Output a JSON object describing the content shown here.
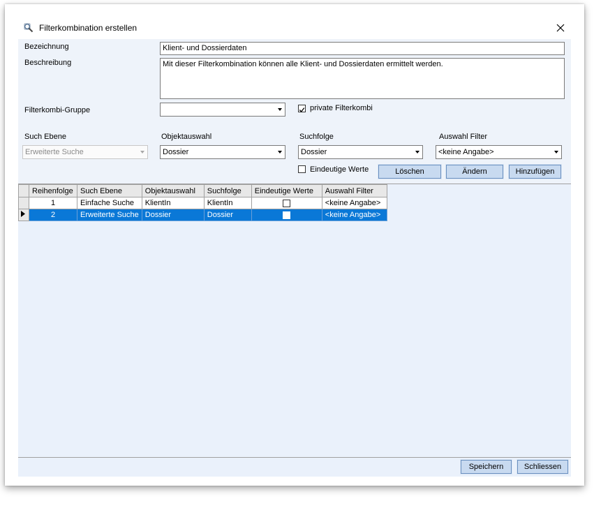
{
  "window": {
    "title": "Filterkombination erstellen"
  },
  "form": {
    "bezeichnung_label": "Bezeichnung",
    "bezeichnung_value": "Klient- und Dossierdaten",
    "beschreibung_label": "Beschreibung",
    "beschreibung_value": "Mit dieser Filterkombination können alle Klient- und Dossierdaten ermittelt werden.",
    "gruppe_label": "Filterkombi-Gruppe",
    "gruppe_value": "",
    "private_label": "private Filterkombi",
    "private_checked": true,
    "such_ebene_label": "Such Ebene",
    "such_ebene_value": "Erweiterte Suche",
    "objektauswahl_label": "Objektauswahl",
    "objektauswahl_value": "Dossier",
    "suchfolge_label": "Suchfolge",
    "suchfolge_value": "Dossier",
    "auswahl_filter_label": "Auswahl Filter",
    "auswahl_filter_value": "<keine Angabe>",
    "eindeutige_label": "Eindeutige Werte",
    "eindeutige_checked": false
  },
  "buttons": {
    "loeschen": "Löschen",
    "aendern": "Ändern",
    "hinzufuegen": "Hinzufügen",
    "speichern": "Speichern",
    "schliessen": "Schliessen"
  },
  "grid": {
    "columns": [
      "Reihenfolge",
      "Such Ebene",
      "Objektauswahl",
      "Suchfolge",
      "Eindeutige Werte",
      "Auswahl Filter"
    ],
    "rows": [
      {
        "reihenfolge": "1",
        "such_ebene": "Einfache Suche",
        "objektauswahl": "KlientIn",
        "suchfolge": "KlientIn",
        "eindeutig": false,
        "filter": "<keine Angabe>"
      },
      {
        "reihenfolge": "2",
        "such_ebene": "Erweiterte Suche",
        "objektauswahl": "Dossier",
        "suchfolge": "Dossier",
        "eindeutig": false,
        "filter": "<keine Angabe>"
      }
    ],
    "selected_row": 2
  },
  "icons": {
    "title": "magnifier-icon",
    "close": "close-icon",
    "dropdown": "chevron-down-icon",
    "check": "checkmark-icon",
    "row_pointer": "row-pointer-icon"
  },
  "colors": {
    "panel": "#eef3fa",
    "selection": "#0a78d7",
    "button": "#c8daf0"
  }
}
